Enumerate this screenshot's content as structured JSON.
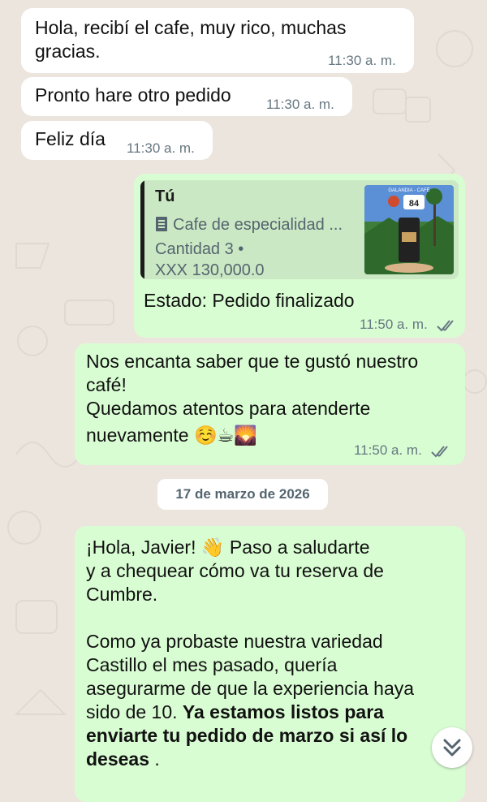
{
  "messages": [
    {
      "text_lines": [
        "Hola, recibí el cafe, muy rico, muchas",
        "gracias."
      ],
      "time": "11:30 a. m."
    },
    {
      "text": "Pronto hare otro pedido",
      "time": "11:30 a. m."
    },
    {
      "text": "Feliz día",
      "time": "11:30 a. m."
    }
  ],
  "order_message": {
    "quote": {
      "author": "Tú",
      "product": "Cafe de especialidad ...",
      "quantity": "Cantidad 3 •",
      "price": "XXX 130,000.0",
      "thumb_label": "84",
      "thumb_title": "GALANDIA - CAFÉ"
    },
    "status": "Estado: Pedido finalizado",
    "time": "11:50 a. m."
  },
  "reply_message": {
    "lines": [
      "Nos encanta saber que te gustó nuestro",
      "café!",
      "Quedamos atentos para atenderte",
      "nuevamente"
    ],
    "emojis": [
      "☺️",
      "☕",
      "🌄"
    ],
    "time": "11:50 a. m."
  },
  "date_separator": "17 de marzo de 2026",
  "followup_message": {
    "line1_before": "¡Hola, Javier!",
    "line1_emoji": "👋",
    "line1_after": "Paso a saludarte",
    "line2": "y a chequear cómo va tu reserva de",
    "line3": "Cumbre.",
    "line4": "Como ya probaste nuestra variedad",
    "line5": "Castillo el mes pasado, quería",
    "line6": "asegurarme de que la experiencia haya",
    "line7_before": "sido de 10.",
    "line7_bold": "Ya estamos listos para",
    "line8_bold": "enviarte tu pedido de marzo si así lo",
    "line9_bold": "deseas",
    "line9_after": "."
  },
  "icons": {
    "document": "document-icon",
    "read_receipt": "double-check-icon",
    "scroll_down": "double-chevron-down-icon"
  },
  "colors": {
    "chat_bg": "#ece5dd",
    "incoming": "#ffffff",
    "outgoing": "#d9fdd3",
    "quote_bg": "#cbe8c4"
  }
}
